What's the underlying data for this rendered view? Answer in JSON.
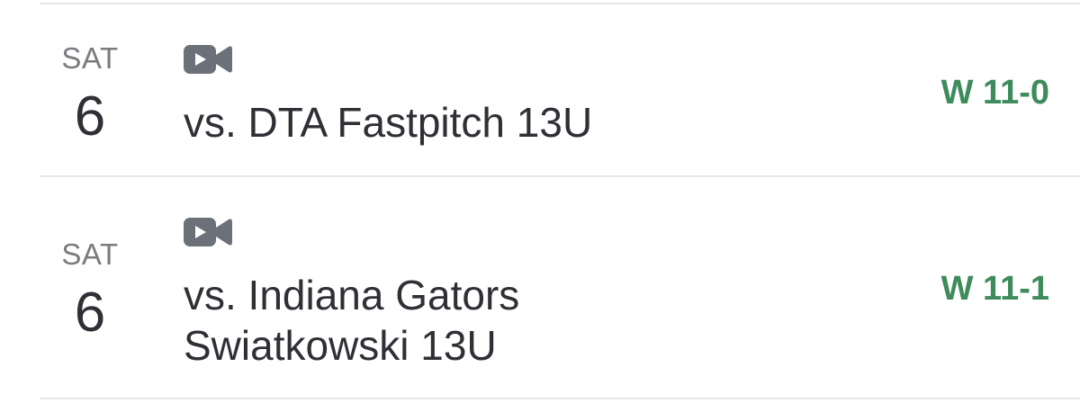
{
  "colors": {
    "win": "#3e8b5c",
    "text": "#2f3035",
    "muted": "#7b7b80",
    "icon": "#6c7079",
    "divider": "#e5e5ea"
  },
  "games": [
    {
      "dow": "SAT",
      "day": "6",
      "icon": "video-camera-icon",
      "title_line1": "vs. DTA Fastpitch 13U",
      "title_line2": "",
      "result": "W 11-0"
    },
    {
      "dow": "SAT",
      "day": "6",
      "icon": "video-camera-icon",
      "title_line1": "vs. Indiana Gators",
      "title_line2": "Swiatkowski 13U",
      "result": "W 11-1"
    }
  ]
}
